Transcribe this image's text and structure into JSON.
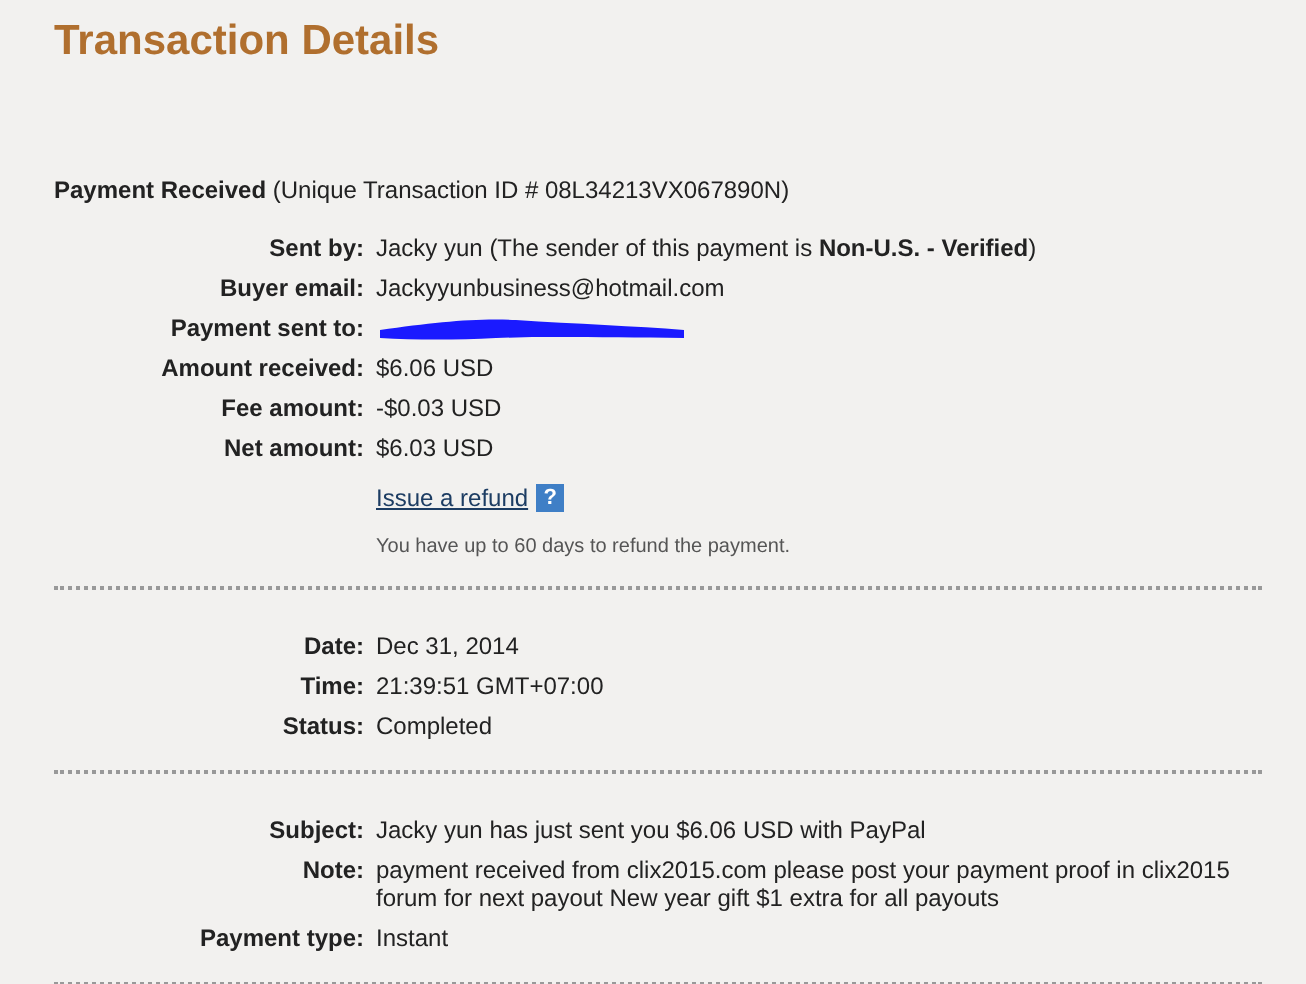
{
  "title": "Transaction Details",
  "header": "**Payment Received** (Unique Transaction ID # 08L34213VX067890N)",
  "sections": [
    {
      "rows": [
        {
          "kind": "text",
          "label": "Sent by:",
          "value": "Jacky yun (The sender of this payment is **Non-U.S. - Verified**)"
        },
        {
          "kind": "text",
          "label": "Buyer email:",
          "value": "Jackyyunbusiness@hotmail.com"
        },
        {
          "kind": "redacted",
          "label": "Payment sent to:"
        },
        {
          "kind": "text",
          "label": "Amount received:",
          "value": "$6.06 USD"
        },
        {
          "kind": "text",
          "label": "Fee amount:",
          "value": "-$0.03 USD"
        },
        {
          "kind": "text",
          "label": "Net amount:",
          "value": "$6.03 USD"
        }
      ],
      "refund": {
        "link": "Issue a refund",
        "help": "?",
        "hint": "You have up to 60 days to refund the payment."
      }
    },
    {
      "rows": [
        {
          "kind": "text",
          "label": "Date:",
          "value": "Dec 31, 2014"
        },
        {
          "kind": "text",
          "label": "Time:",
          "value": "21:39:51 GMT+07:00"
        },
        {
          "kind": "text",
          "label": "Status:",
          "value": "Completed"
        }
      ]
    },
    {
      "rows": [
        {
          "kind": "text",
          "label": "Subject:",
          "value": "Jacky yun has just sent you $6.06 USD with PayPal"
        },
        {
          "kind": "text",
          "label": "Note:",
          "value": "payment received from clix2015.com please post your payment proof in clix2015 forum for next payout New year gift $1 extra for all payouts"
        },
        {
          "kind": "text",
          "label": "Payment type:",
          "value": "Instant"
        }
      ]
    }
  ]
}
